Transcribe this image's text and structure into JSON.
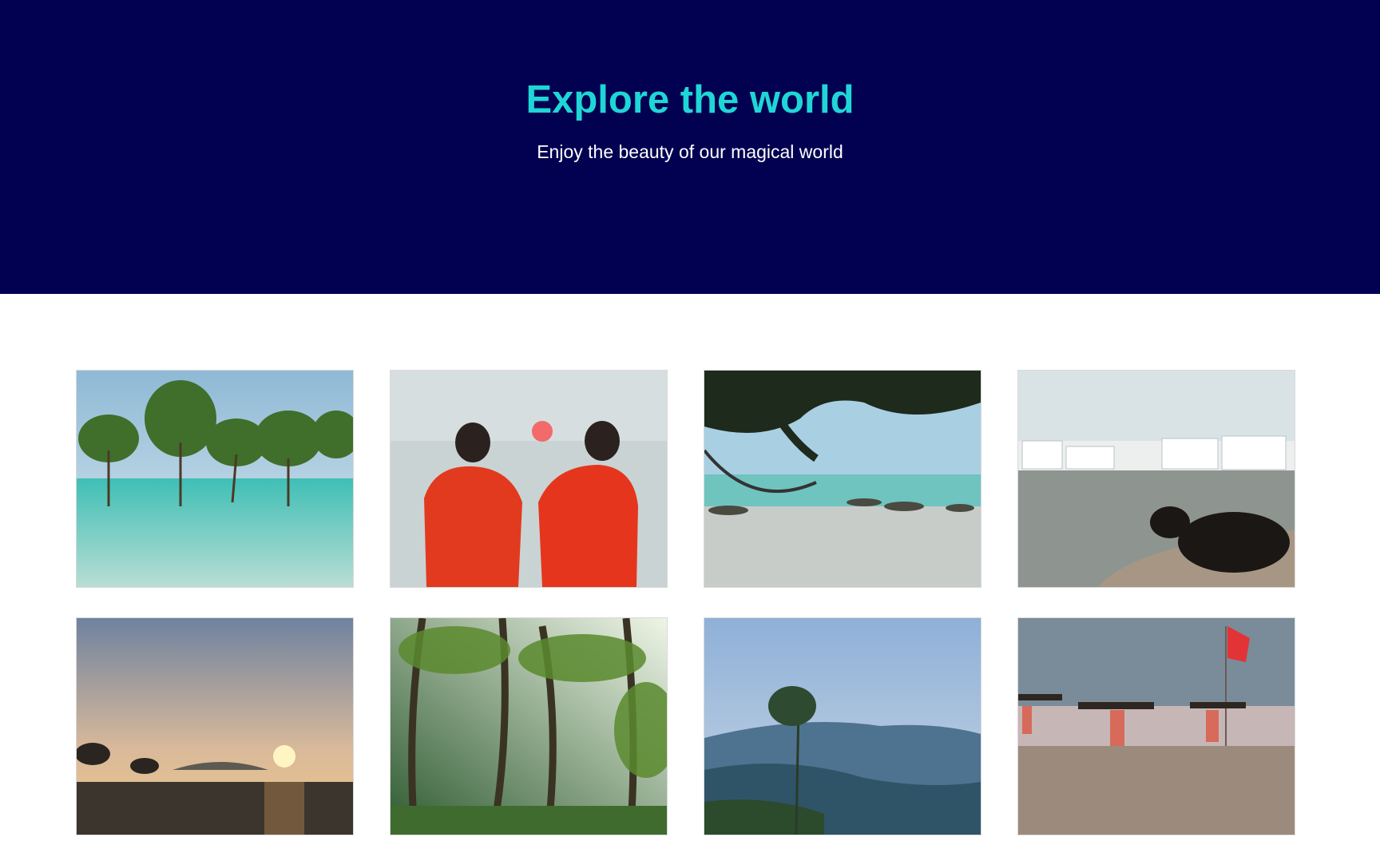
{
  "hero": {
    "title": "Explore the world",
    "subtitle": "Enjoy the beauty of our magical world",
    "background_color": "#020050",
    "title_color": "#1fd6d6"
  },
  "gallery": {
    "photos": [
      {
        "subject": "mangrove trees in turquoise sea"
      },
      {
        "subject": "two women in red saris watching sunset over sea"
      },
      {
        "subject": "hammock under tree on rocky beach"
      },
      {
        "subject": "black cow resting by lake with white town"
      },
      {
        "subject": "sunset over tidal flats with trees"
      },
      {
        "subject": "sunlit palm forest"
      },
      {
        "subject": "misty blue hills with tall tree"
      },
      {
        "subject": "women carrying firewood on beach with red flag"
      }
    ]
  }
}
